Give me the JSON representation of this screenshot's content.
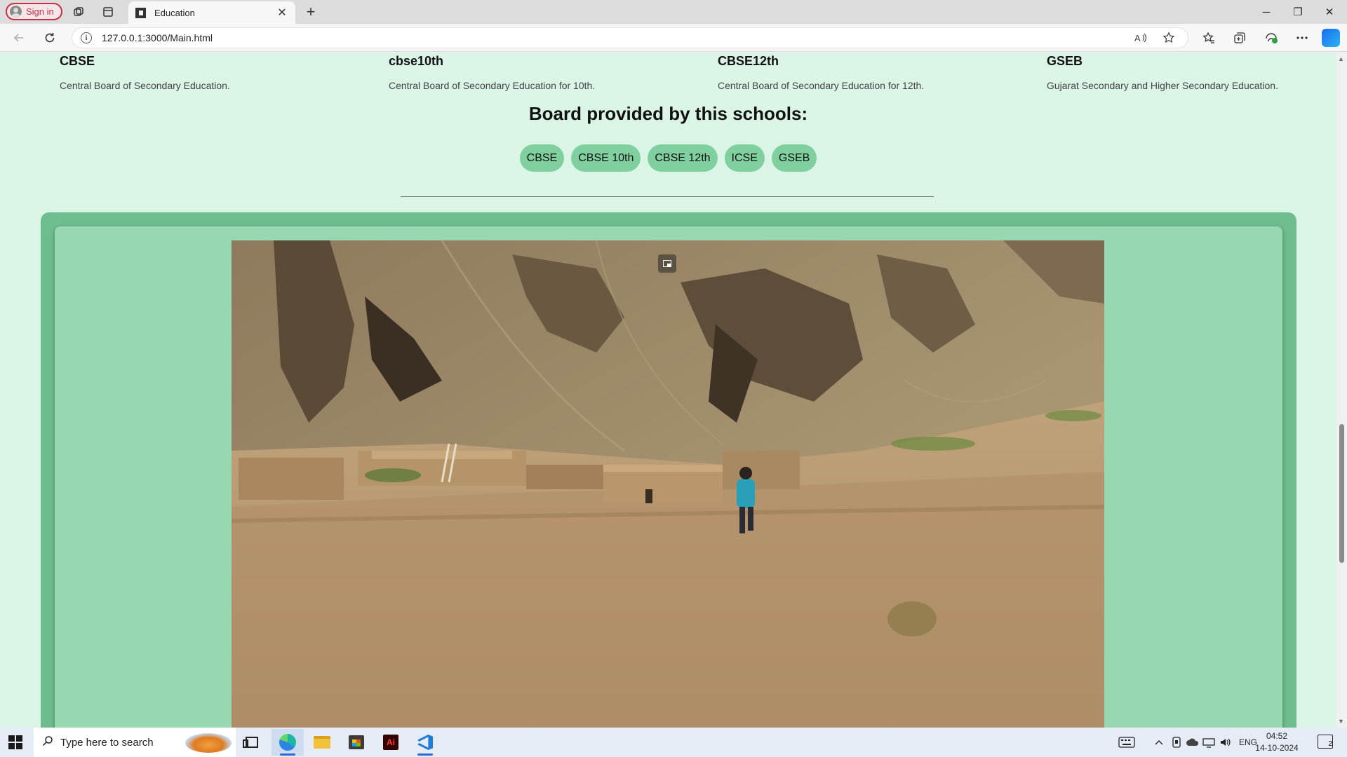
{
  "browser": {
    "signin_label": "Sign in",
    "tab_title": "Education",
    "url": "127.0.0.1:3000/Main.html",
    "new_tab_glyph": "+",
    "tab_close_glyph": "✕",
    "window_controls": {
      "minimize": "─",
      "restore": "❐",
      "close": "✕"
    },
    "icons": {
      "workspaces": "workspaces-icon",
      "tab_actions": "tab-actions-icon",
      "back": "back-arrow-icon",
      "refresh": "refresh-icon",
      "read_aloud": "read-aloud-icon",
      "favorite": "star-icon",
      "favorites": "favorites-icon",
      "collections": "collections-icon",
      "browser_essentials": "browser-essentials-icon",
      "more": "more-icon",
      "copilot": "copilot-icon"
    }
  },
  "page": {
    "boards": [
      {
        "name": "CBSE",
        "description": "Central Board of Secondary Education."
      },
      {
        "name": "cbse10th",
        "description": "Central Board of Secondary Education for 10th."
      },
      {
        "name": "CBSE12th",
        "description": "Central Board of Secondary Education for 12th."
      },
      {
        "name": "GSEB",
        "description": "Gujarat Secondary and Higher Secondary Education."
      }
    ],
    "section_title": "Board provided by this schools:",
    "pills": [
      "CBSE",
      "CBSE 10th",
      "CBSE 12th",
      "ICSE",
      "GSEB"
    ],
    "media_icon": "picture-in-picture-icon"
  },
  "colors": {
    "page_bg": "#daf5e6",
    "pill_bg": "#7fcf9f",
    "outer_panel": "#6dbd8f",
    "inner_panel": "#97d7b1"
  },
  "taskbar": {
    "search_placeholder": "Type here to search",
    "language": "ENG",
    "time": "04:52",
    "date": "14-10-2024",
    "notification_count": "2",
    "apps": [
      "task-view-icon",
      "edge-icon",
      "file-explorer-icon",
      "store-icon",
      "illustrator-icon",
      "vscode-icon"
    ],
    "illustrator_label": "Ai"
  }
}
